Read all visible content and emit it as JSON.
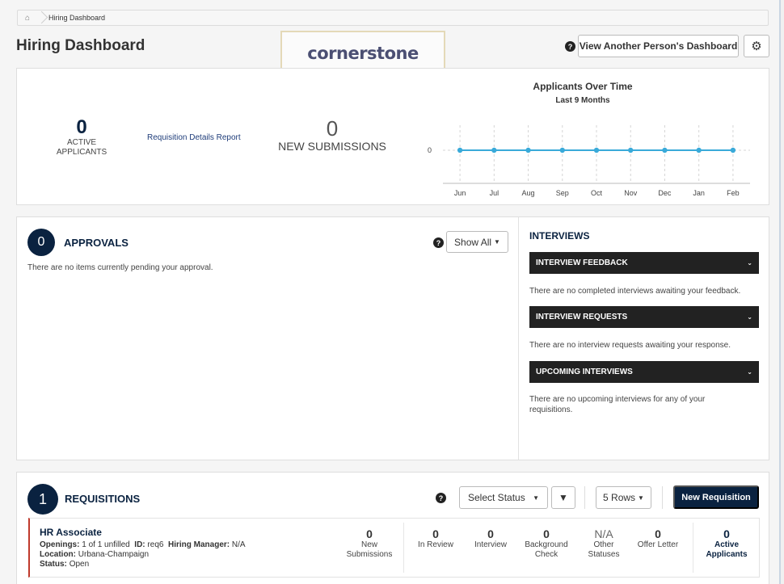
{
  "breadcrumb": {
    "current": "Hiring Dashboard"
  },
  "header": {
    "title": "Hiring Dashboard",
    "logo": "cornerstone",
    "help_glyph": "?",
    "view_button": "View Another Person's Dashboard",
    "settings_glyph": "⚙"
  },
  "stats": {
    "active_count": "0",
    "active_label_1": "ACTIVE",
    "active_label_2": "APPLICANTS",
    "report_link": "Requisition Details Report",
    "new_count": "0",
    "new_label": "NEW SUBMISSIONS"
  },
  "chart_data": {
    "type": "line",
    "title": "Applicants Over Time",
    "subtitle": "Last 9 Months",
    "categories": [
      "Jun",
      "Jul",
      "Aug",
      "Sep",
      "Oct",
      "Nov",
      "Dec",
      "Jan",
      "Feb"
    ],
    "series": [
      {
        "values": [
          0,
          0,
          0,
          0,
          0,
          0,
          0,
          0,
          0
        ],
        "color": "#3aaad9"
      }
    ],
    "y_ticks": [
      "0"
    ],
    "ylim": [
      -1,
      1
    ],
    "grid": "vertical-dashed"
  },
  "approvals": {
    "count": "0",
    "title": "APPROVALS",
    "empty": "There are no items currently pending your approval.",
    "show_all": "Show All",
    "caret": "▼"
  },
  "interviews": {
    "title": "INTERVIEWS",
    "chevron": "⌄",
    "sections": [
      {
        "label": "INTERVIEW FEEDBACK",
        "text": "There are no completed interviews awaiting your feedback."
      },
      {
        "label": "INTERVIEW REQUESTS",
        "text": "There are no interview requests awaiting your response."
      },
      {
        "label": "UPCOMING INTERVIEWS",
        "text": "There are no upcoming interviews for any of your requisitions."
      }
    ]
  },
  "requisitions": {
    "count": "1",
    "title": "REQUISITIONS",
    "status_select": "Select Status",
    "select_caret": "▼",
    "filter_glyph": "▼",
    "rows_button": "5 Rows",
    "rows_caret": "▼",
    "new_button": "New Requisition",
    "items": [
      {
        "name": "HR Associate",
        "openings_label": "Openings:",
        "openings_value": "1 of 1 unfilled",
        "id_label": "ID:",
        "id_value": "req6",
        "hm_label": "Hiring Manager:",
        "hm_value": "N/A",
        "location_label": "Location:",
        "location_value": "Urbana-Champaign",
        "status_label": "Status:",
        "status_value": "Open",
        "columns": [
          {
            "value": "0",
            "label_1": "New",
            "label_2": "Submissions"
          },
          {
            "value": "0",
            "label_1": "In Review",
            "label_2": ""
          },
          {
            "value": "0",
            "label_1": "Interview",
            "label_2": ""
          },
          {
            "value": "0",
            "label_1": "Background",
            "label_2": "Check"
          },
          {
            "value": "N/A",
            "label_1": "Other",
            "label_2": "Statuses"
          },
          {
            "value": "0",
            "label_1": "Offer Letter",
            "label_2": ""
          },
          {
            "value": "0",
            "label_1": "Active",
            "label_2": "Applicants"
          }
        ]
      }
    ]
  },
  "colors": {
    "navy": "#0a2240",
    "line": "#3aaad9",
    "accent_red": "#c0392b",
    "dark_bar": "#222222"
  }
}
